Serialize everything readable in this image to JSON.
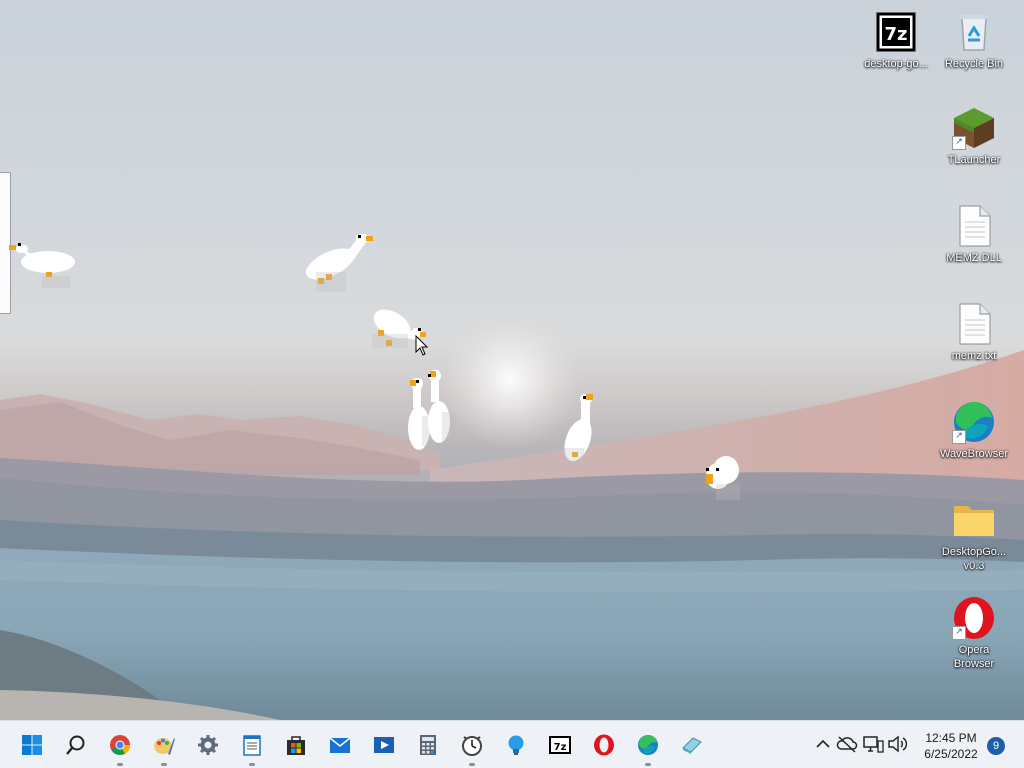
{
  "desktop": {
    "icons": [
      {
        "name": "desktop-goose-7z",
        "label": "desktop-go...",
        "icon": "7zip-archive-icon"
      },
      {
        "name": "recycle-bin",
        "label": "Recycle Bin",
        "icon": "recycle-bin-icon"
      },
      {
        "name": "tlauncher",
        "label": "TLauncher",
        "icon": "minecraft-grass-block-icon"
      },
      {
        "name": "memz-dll",
        "label": "MEMZ.DLL",
        "icon": "file-icon"
      },
      {
        "name": "memz-txt",
        "label": "memz.txt",
        "icon": "text-file-icon"
      },
      {
        "name": "wavebrowser",
        "label": "WaveBrowser",
        "icon": "wavebrowser-icon"
      },
      {
        "name": "desktopgoose-folder",
        "label": "DesktopGo... v0.3",
        "icon": "folder-icon"
      },
      {
        "name": "opera-browser",
        "label": "Opera Browser",
        "icon": "opera-icon"
      }
    ],
    "geese_count": 8
  },
  "taskbar": {
    "apps": [
      {
        "name": "start",
        "icon": "windows-logo-icon"
      },
      {
        "name": "search",
        "icon": "search-icon"
      },
      {
        "name": "chrome",
        "icon": "chrome-icon",
        "running": true
      },
      {
        "name": "paint",
        "icon": "paint-icon",
        "running": true
      },
      {
        "name": "settings",
        "icon": "gear-icon"
      },
      {
        "name": "notepad",
        "icon": "notepad-icon",
        "running": true
      },
      {
        "name": "store",
        "icon": "store-icon"
      },
      {
        "name": "mail",
        "icon": "mail-icon"
      },
      {
        "name": "media-player",
        "icon": "media-player-icon"
      },
      {
        "name": "calculator",
        "icon": "calculator-icon"
      },
      {
        "name": "clock",
        "icon": "clock-icon",
        "running": true
      },
      {
        "name": "tips",
        "icon": "lightbulb-icon"
      },
      {
        "name": "7zip",
        "icon": "7zip-icon"
      },
      {
        "name": "opera",
        "icon": "opera-icon"
      },
      {
        "name": "wavebrowser",
        "icon": "wavebrowser-icon",
        "running": true
      },
      {
        "name": "eraser",
        "icon": "eraser-icon"
      }
    ],
    "tray": {
      "chevron": "chevron-up-icon",
      "time": "12:45 PM",
      "date": "6/25/2022",
      "notifications": "9"
    }
  },
  "colors": {
    "taskbar_bg": "#eef1f6",
    "accent": "#0067c0",
    "goose_beak": "#f0a21a"
  }
}
